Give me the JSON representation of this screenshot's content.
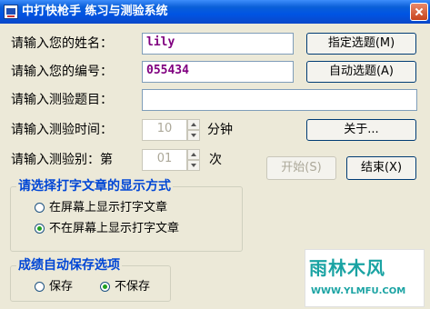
{
  "window": {
    "title": "中打快枪手  练习与测验系统"
  },
  "form": {
    "name_label": "请输入您的姓名：",
    "name_value": "lily",
    "id_label": "请输入您的编号：",
    "id_value": "055434",
    "topic_label": "请输入测验题目：",
    "topic_value": "",
    "time_label": "请输入测验时间：",
    "time_value": "10",
    "time_unit": "分钟",
    "level_label": "请输入测验别：第",
    "level_value": "01",
    "level_unit": "次"
  },
  "buttons": {
    "select_topic": "指定选题(M)",
    "auto_topic": "自动选题(A)",
    "about": "关于...",
    "start": "开始(S)",
    "end": "结束(X)"
  },
  "display_group": {
    "title": "请选择打字文章的显示方式",
    "options": [
      {
        "label": "在屏幕上显示打字文章",
        "checked": false
      },
      {
        "label": "不在屏幕上显示打字文章",
        "checked": true
      }
    ]
  },
  "save_group": {
    "title": "成绩自动保存选项",
    "options": [
      {
        "label": "保存",
        "checked": false
      },
      {
        "label": "不保存",
        "checked": true
      }
    ]
  },
  "watermark": {
    "main": "雨林木风",
    "sub": "WWW.YLMFU.COM"
  },
  "colors": {
    "accent": "#0046d5",
    "title_bar": "#0054e3",
    "input_text": "#800080"
  }
}
